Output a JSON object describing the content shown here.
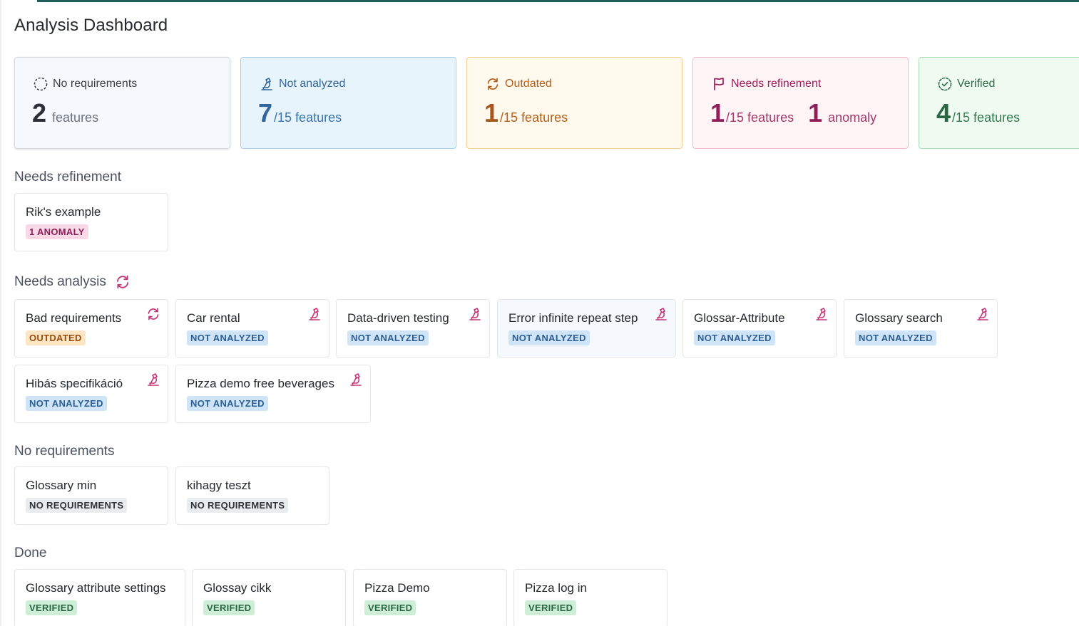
{
  "page": {
    "title": "Analysis Dashboard"
  },
  "stats": {
    "no_requirements": {
      "label": "No requirements",
      "count": "2",
      "suffix": "features",
      "icon": "dashed-circle-icon"
    },
    "not_analyzed": {
      "label": "Not analyzed",
      "count": "7",
      "suffix": "/15 features",
      "icon": "microscope-icon"
    },
    "outdated": {
      "label": "Outdated",
      "count": "1",
      "suffix": "/15 features",
      "icon": "refresh-icon"
    },
    "needs_refinement": {
      "label": "Needs refinement",
      "count": "1",
      "suffix": "/15 features",
      "anomaly_count": "1",
      "anomaly_suffix": "anomaly",
      "icon": "flag-icon"
    },
    "verified": {
      "label": "Verified",
      "count": "4",
      "suffix": "/15 features",
      "icon": "check-circle-icon"
    }
  },
  "sections": {
    "needs_refinement": {
      "title": "Needs refinement",
      "cards": [
        {
          "name": "Rik's example",
          "badge": "1 ANOMALY"
        }
      ]
    },
    "needs_analysis": {
      "title": "Needs analysis",
      "icon": "refresh-icon",
      "cards": [
        {
          "name": "Bad requirements",
          "badge": "OUTDATED",
          "icon": "refresh-icon"
        },
        {
          "name": "Car rental",
          "badge": "NOT ANALYZED",
          "icon": "microscope-icon"
        },
        {
          "name": "Data-driven testing",
          "badge": "NOT ANALYZED",
          "icon": "microscope-icon"
        },
        {
          "name": "Error infinite repeat step",
          "badge": "NOT ANALYZED",
          "icon": "microscope-icon"
        },
        {
          "name": "Glossar-Attribute",
          "badge": "NOT ANALYZED",
          "icon": "microscope-icon"
        },
        {
          "name": "Glossary search",
          "badge": "NOT ANALYZED",
          "icon": "microscope-icon"
        },
        {
          "name": "Hibás specifikáció",
          "badge": "NOT ANALYZED",
          "icon": "microscope-icon"
        },
        {
          "name": "Pizza demo free beverages",
          "badge": "NOT ANALYZED",
          "icon": "microscope-icon"
        }
      ]
    },
    "no_requirements": {
      "title": "No requirements",
      "cards": [
        {
          "name": "Glossary min",
          "badge": "NO REQUIREMENTS"
        },
        {
          "name": "kihagy teszt",
          "badge": "NO REQUIREMENTS"
        }
      ]
    },
    "done": {
      "title": "Done",
      "cards": [
        {
          "name": "Glossary attribute settings",
          "badge": "VERIFIED"
        },
        {
          "name": "Glossay cikk",
          "badge": "VERIFIED"
        },
        {
          "name": "Pizza Demo",
          "badge": "VERIFIED"
        },
        {
          "name": "Pizza log in",
          "badge": "VERIFIED"
        }
      ]
    }
  },
  "colors": {
    "accent_topbar": "#1f5f5b",
    "not_analyzed": "#33669c",
    "outdated": "#b35f1a",
    "refinement": "#9c1f5a",
    "verified": "#2d6b47",
    "icon_pink": "#c2387a"
  }
}
